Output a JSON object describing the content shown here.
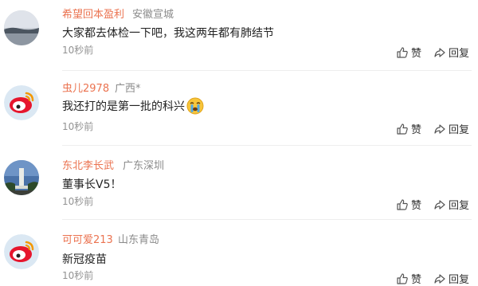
{
  "comments": [
    {
      "username": "希望回本盈利",
      "location": "安徽宣城",
      "text": "大家都去体检一下吧，我这两年都有肺结节",
      "time": "10秒前",
      "like_label": "赞",
      "reply_label": "回复",
      "avatar": "landscape-photo"
    },
    {
      "username": "虫儿2978",
      "location": "广西*",
      "text": "我还打的是第一批的科兴",
      "emoji": "crying-face",
      "time": "10秒前",
      "like_label": "赞",
      "reply_label": "回复",
      "avatar": "weibo-logo"
    },
    {
      "username": "东北李长武",
      "location": "广东深圳",
      "text": "董事长V5！",
      "time": "10秒前",
      "like_label": "赞",
      "reply_label": "回复",
      "avatar": "monument-photo"
    },
    {
      "username": "可可爱213",
      "location": "山东青岛",
      "text": "新冠疫苗",
      "time": "10秒前",
      "like_label": "赞",
      "reply_label": "回复",
      "avatar": "weibo-logo"
    }
  ],
  "colors": {
    "username": "#eb7350",
    "location": "#8a8a8a",
    "time": "#939393"
  }
}
